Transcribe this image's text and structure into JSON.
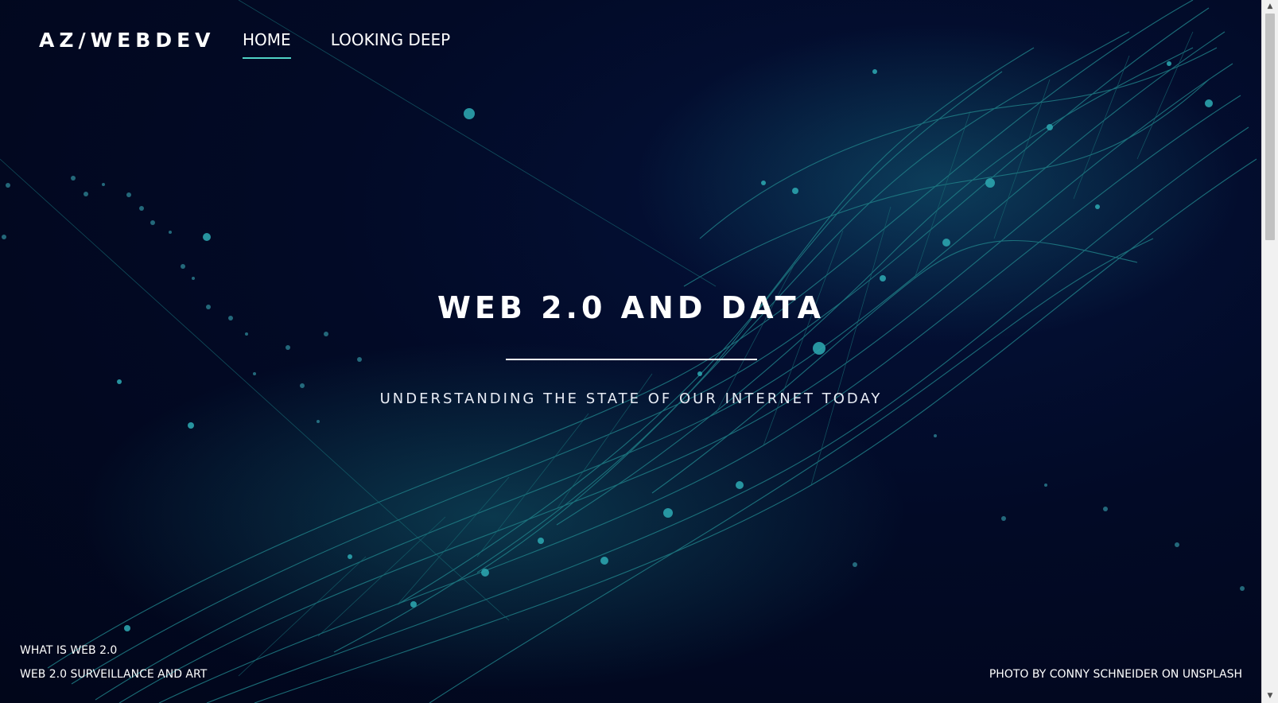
{
  "brand": {
    "logo": "AZ/WEBDEV"
  },
  "nav": {
    "items": [
      {
        "label": "HOME",
        "active": true
      },
      {
        "label": "LOOKING DEEP",
        "active": false
      }
    ]
  },
  "hero": {
    "title": "WEB 2.0 AND DATA",
    "subtitle": "UNDERSTANDING THE STATE OF OUR INTERNET TODAY"
  },
  "footer": {
    "links": [
      {
        "label": "WHAT IS WEB 2.0"
      },
      {
        "label": "WEB 2.0 SURVEILLANCE AND ART"
      }
    ],
    "credit": "PHOTO BY CONNY SCHNEIDER ON UNSPLASH"
  },
  "colors": {
    "background": "#020a24",
    "accent": "#4fd1c5",
    "network": "#1f7e86"
  },
  "icons": {
    "scroll_up": "chevron-up-icon",
    "scroll_down": "chevron-down-icon"
  }
}
